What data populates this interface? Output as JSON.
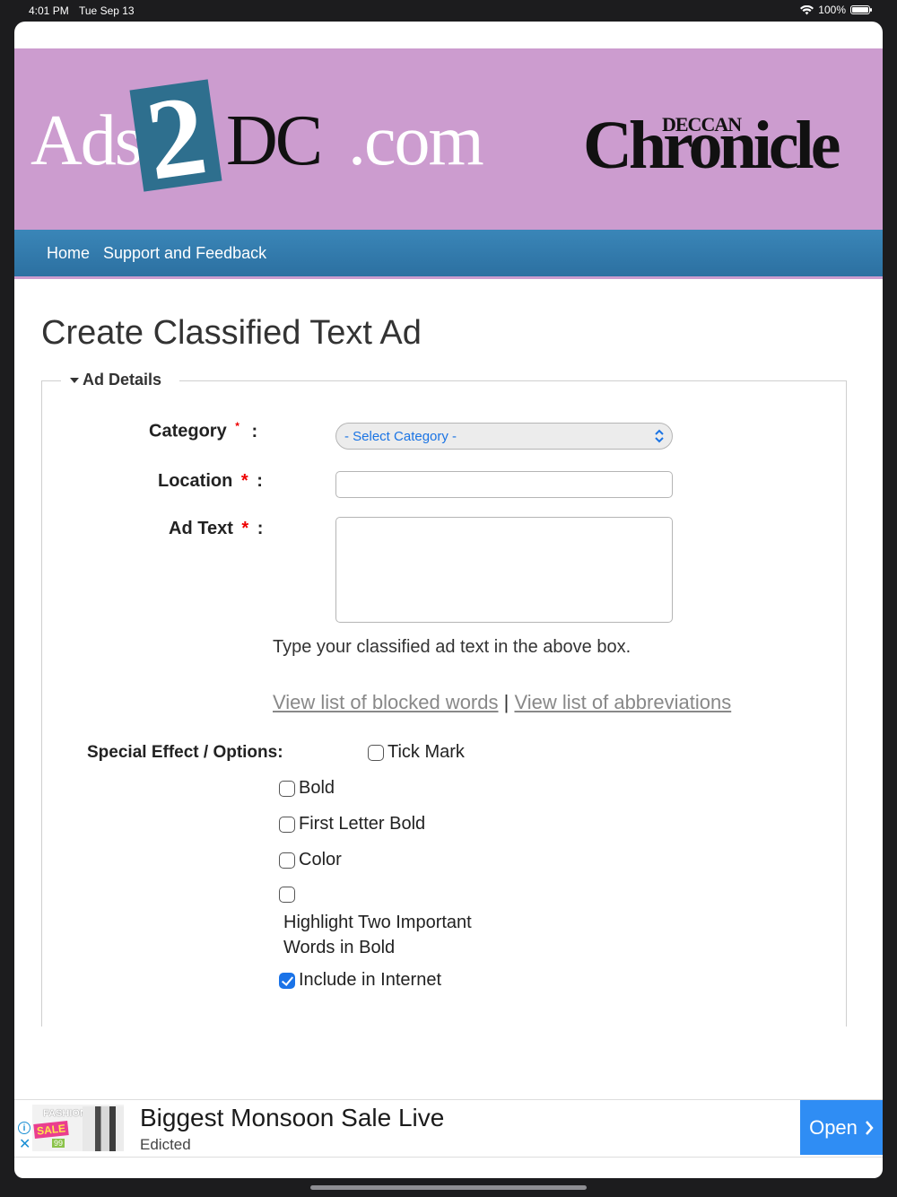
{
  "status_bar": {
    "time": "4:01 PM",
    "date": "Tue Sep 13",
    "battery": "100%",
    "battery_level": 1.0
  },
  "header": {
    "logo_left": {
      "part1": "Ads",
      "part2": "2",
      "part3": "DC",
      "part4": ".com"
    },
    "logo_right": {
      "small": "DECCAN",
      "big": "Chronicle"
    },
    "background_color": "#cc9ccf"
  },
  "nav": {
    "items": [
      "Home",
      "Support and Feedback"
    ],
    "color": "#3a86b8"
  },
  "page": {
    "title": "Create Classified Text Ad"
  },
  "form": {
    "legend": "Ad Details",
    "category_label": "Category",
    "location_label": "Location",
    "adtext_label": "Ad Text",
    "required_mark": "*",
    "colon": ":",
    "category_value": "- Select Category -",
    "location_value": "",
    "adtext_value": "",
    "help_text": "Type your classified ad text in the above box.",
    "link_blocked": "View list of blocked words",
    "link_separator": "|",
    "link_abbrev": "View list of abbreviations",
    "options_label": "Special Effect / Options:",
    "options": [
      {
        "label": "Tick Mark",
        "checked": false
      },
      {
        "label": "Bold",
        "checked": false
      },
      {
        "label": "First Letter Bold",
        "checked": false
      },
      {
        "label": "Color",
        "checked": false
      },
      {
        "label": "Highlight Two Important Words in Bold",
        "checked": false
      },
      {
        "label": "Include in Internet",
        "checked": true
      }
    ]
  },
  "ad_banner": {
    "thumb_text": {
      "fashion": "FASHION",
      "sale": "SALE",
      "price": "99"
    },
    "title": "Biggest Monsoon Sale Live",
    "advertiser": "Edicted",
    "cta": "Open",
    "cta_icon": "chevron-right-icon",
    "cta_color": "#2f8df4"
  }
}
